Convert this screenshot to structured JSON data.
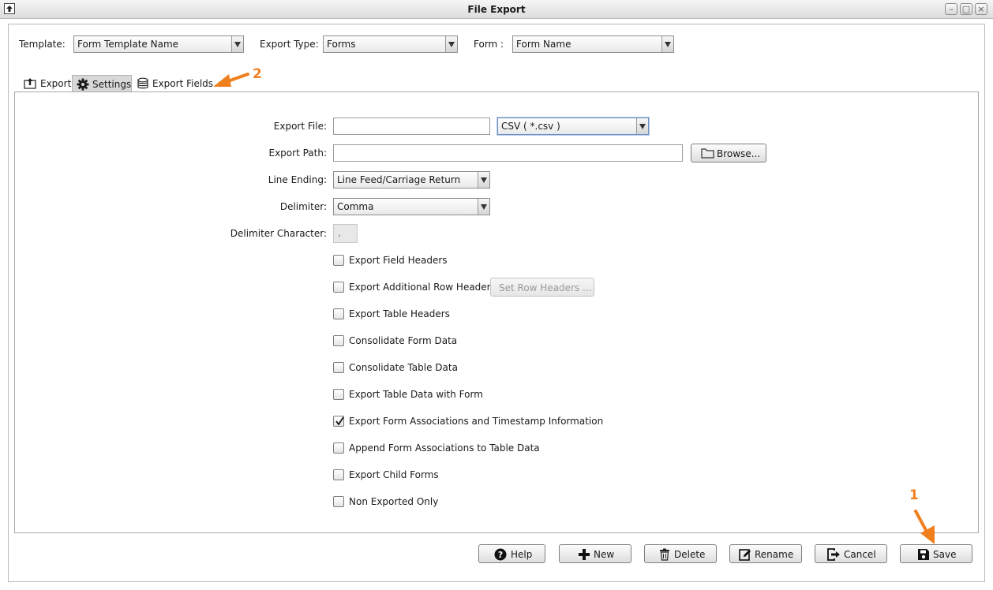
{
  "window": {
    "title": "File Export",
    "minimize": "–",
    "maximize": "□",
    "close": "×"
  },
  "top": {
    "template_label": "Template:",
    "template_value": "Form Template Name",
    "export_type_label": "Export Type:",
    "export_type_value": "Forms",
    "form_label": "Form :",
    "form_value": "Form Name"
  },
  "tabs": [
    {
      "label": "Export",
      "icon": "export-icon"
    },
    {
      "label": "Settings",
      "icon": "gear-icon",
      "selected": true
    },
    {
      "label": "Export Fields",
      "icon": "database-icon"
    }
  ],
  "settings": {
    "export_file_label": "Export File:",
    "export_file_value": "",
    "file_type_value": "CSV ( *.csv )",
    "export_path_label": "Export Path:",
    "export_path_value": "",
    "browse_label": "Browse...",
    "line_ending_label": "Line Ending:",
    "line_ending_value": "Line Feed/Carriage Return",
    "delimiter_label": "Delimiter:",
    "delimiter_value": "Comma",
    "delimiter_char_label": "Delimiter Character:",
    "delimiter_char_value": ",",
    "set_row_headers_label": "Set Row Headers ...",
    "options": [
      {
        "label": "Export Field Headers",
        "checked": false
      },
      {
        "label": "Export Additional Row Headers",
        "checked": false
      },
      {
        "label": "Export Table Headers",
        "checked": false
      },
      {
        "label": "Consolidate Form Data",
        "checked": false
      },
      {
        "label": "Consolidate Table Data",
        "checked": false
      },
      {
        "label": "Export Table Data with Form",
        "checked": false
      },
      {
        "label": "Export Form Associations and Timestamp Information",
        "checked": true
      },
      {
        "label": "Append Form Associations to Table Data",
        "checked": false
      },
      {
        "label": "Export Child Forms",
        "checked": false
      },
      {
        "label": "Non Exported Only",
        "checked": false
      }
    ]
  },
  "buttons": {
    "help": "Help",
    "new": "New",
    "delete": "Delete",
    "rename": "Rename",
    "cancel": "Cancel",
    "save": "Save"
  },
  "annotations": {
    "one": "1",
    "two": "2"
  },
  "colors": {
    "annotation": "#f07f1e"
  }
}
